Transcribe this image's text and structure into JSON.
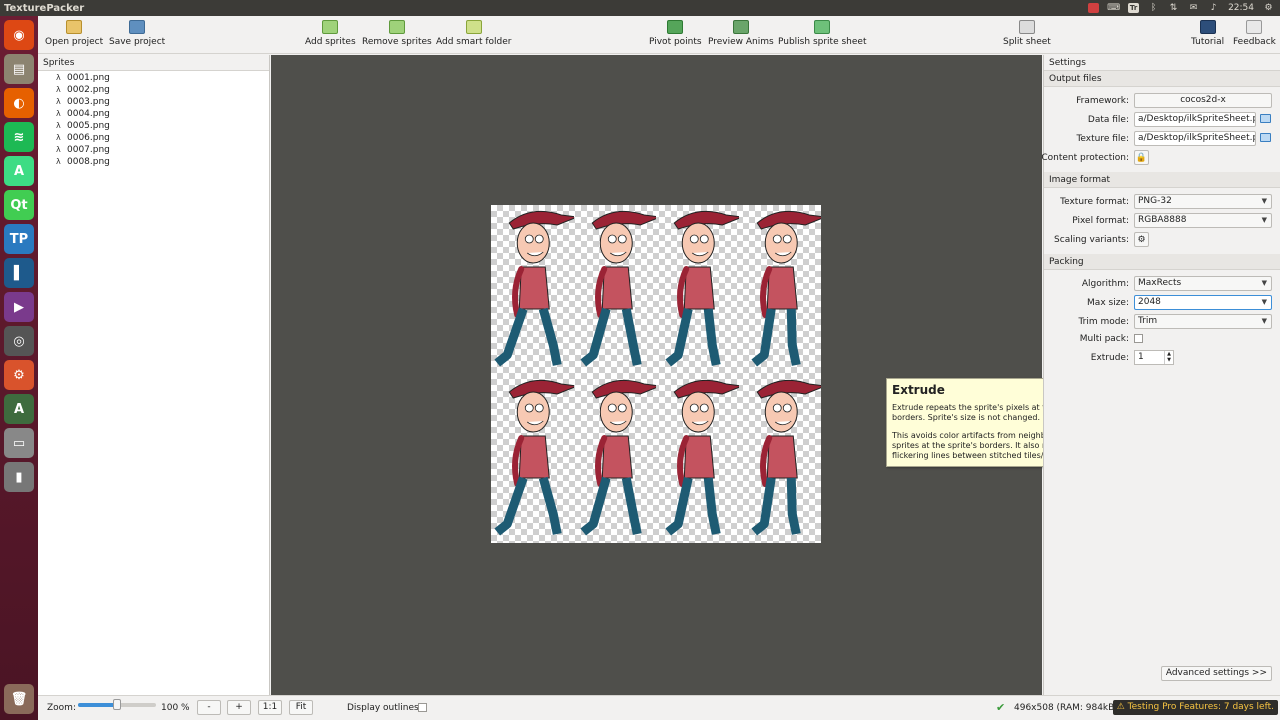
{
  "app": {
    "title": "TexturePacker"
  },
  "tray": {
    "clock": "22:54",
    "text_icon": "Tr"
  },
  "launcher": {
    "items": [
      {
        "name": "ubuntu-icon",
        "glyph": "◉",
        "color": "#dd4814"
      },
      {
        "name": "files-icon",
        "glyph": "▤",
        "color": "#8c8470"
      },
      {
        "name": "firefox-icon",
        "glyph": "◐",
        "color": "#e66000"
      },
      {
        "name": "spotify-icon",
        "glyph": "≋",
        "color": "#1db954"
      },
      {
        "name": "android-studio-icon",
        "glyph": "A",
        "color": "#3ddc84"
      },
      {
        "name": "qt-creator-icon",
        "glyph": "Qt",
        "color": "#41cd52"
      },
      {
        "name": "texturepacker-icon",
        "glyph": "TP",
        "color": "#2a7ac0"
      },
      {
        "name": "book-icon",
        "glyph": "▌",
        "color": "#1e5a8c"
      },
      {
        "name": "video-icon",
        "glyph": "▶",
        "color": "#7a3a8c"
      },
      {
        "name": "camera-icon",
        "glyph": "◎",
        "color": "#555"
      },
      {
        "name": "settings-icon",
        "glyph": "⚙",
        "color": "#d9532c"
      },
      {
        "name": "updater-icon",
        "glyph": "A",
        "color": "#3e6b3e"
      },
      {
        "name": "drive-icon",
        "glyph": "▭",
        "color": "#888"
      },
      {
        "name": "usb-icon",
        "glyph": "▮",
        "color": "#777"
      }
    ],
    "trash": {
      "name": "trash-icon",
      "glyph": "🗑",
      "color": "#8a6a5a"
    }
  },
  "toolbar": {
    "open": "Open project",
    "save": "Save project",
    "add_sprites": "Add sprites",
    "remove_sprites": "Remove sprites",
    "add_smart_folder": "Add smart folder",
    "pivot_points": "Pivot points",
    "preview_anims": "Preview Anims",
    "publish": "Publish sprite sheet",
    "split": "Split sheet",
    "tutorial": "Tutorial",
    "feedback": "Feedback"
  },
  "sprites_panel": {
    "title": "Sprites",
    "items": [
      "0001.png",
      "0002.png",
      "0003.png",
      "0004.png",
      "0005.png",
      "0006.png",
      "0007.png",
      "0008.png"
    ]
  },
  "canvas": {
    "background": "#4f4f4b",
    "sprite_colors": {
      "hat": "#9b2335",
      "shirt": "#c4535f",
      "jeans": "#1e5b73",
      "skin": "#f7c9b3"
    }
  },
  "tooltip": {
    "title": "Extrude",
    "para1": "Extrude repeats the sprite's pixels at the borders. Sprite's size is not changed.",
    "para2": "This avoids color artifacts from neighboring sprites at the sprite's borders. It also reduces flickering lines between stitched tiles/sprites."
  },
  "settings": {
    "title": "Settings",
    "output_files": {
      "heading": "Output files",
      "framework_label": "Framework:",
      "framework_value": "cocos2d-x",
      "data_file_label": "Data file:",
      "data_file_value": "a/Desktop/ilkSpriteSheet.plist",
      "texture_file_label": "Texture file:",
      "texture_file_value": "a/Desktop/ilkSpriteSheet.png",
      "content_protection_label": "Content protection:"
    },
    "image_format": {
      "heading": "Image format",
      "texture_format_label": "Texture format:",
      "texture_format_value": "PNG-32",
      "pixel_format_label": "Pixel format:",
      "pixel_format_value": "RGBA8888",
      "scaling_label": "Scaling variants:"
    },
    "packing": {
      "heading": "Packing",
      "algorithm_label": "Algorithm:",
      "algorithm_value": "MaxRects",
      "max_size_label": "Max size:",
      "max_size_value": "2048",
      "trim_mode_label": "Trim mode:",
      "trim_mode_value": "Trim",
      "multi_pack_label": "Multi pack:",
      "extrude_label": "Extrude:",
      "extrude_value": "1"
    },
    "advanced": "Advanced settings >>"
  },
  "statusbar": {
    "zoom_label": "Zoom:",
    "zoom_fraction": 0.5,
    "zoom_value": "100 %",
    "zoom_out": "-",
    "zoom_in": "+",
    "one_to_one": "1:1",
    "fit": "Fit",
    "display_outlines_label": "Display outlines:",
    "sheet_info": "496x508 (RAM: 984kB)",
    "pro_badge": "Testing Pro Features: 7 days left."
  }
}
